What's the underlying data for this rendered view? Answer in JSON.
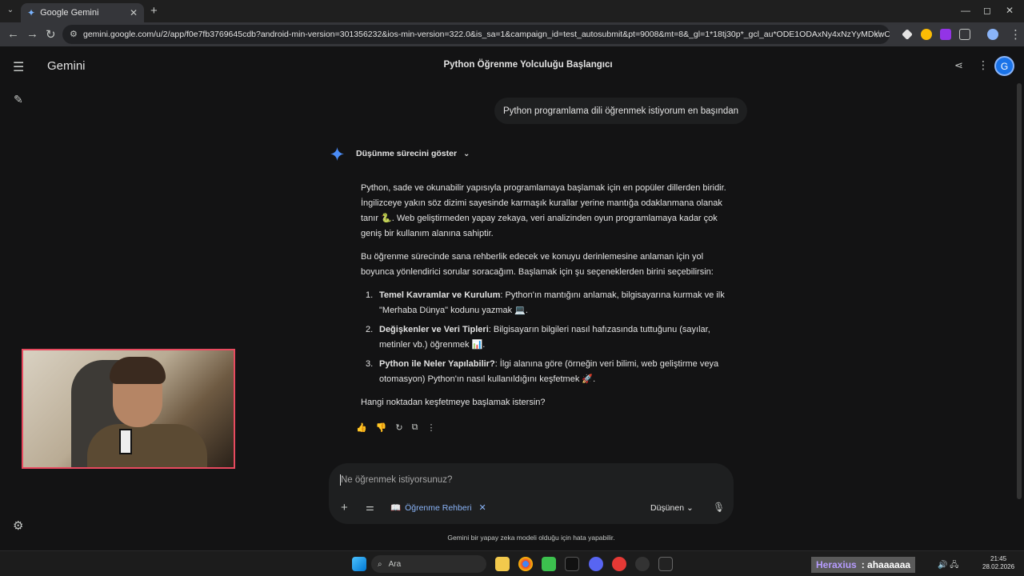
{
  "browser": {
    "tab_title": "Google Gemini",
    "url": "gemini.google.com/u/2/app/f0e7fb3769645cdb?android-min-version=301356232&ios-min-version=322.0&is_sa=1&campaign_id=test_autosubmit&pt=9008&mt=8&_gl=1*18tj30p*_gcl_au*ODE1ODAxNy4xNzYyMDkwOTA2LjUwODE3OT..."
  },
  "app": {
    "brand": "Gemini",
    "chat_title": "Python Öğrenme Yolculuğu Başlangıcı",
    "avatar_letter": "G"
  },
  "conversation": {
    "user_message": "Python programlama dili öğrenmek istiyorum en başından",
    "thinking_label": "Düşünme sürecini göster",
    "paragraph1": "Python, sade ve okunabilir yapısıyla programlamaya başlamak için en popüler dillerden biridir. İngilizceye yakın söz dizimi sayesinde karmaşık kurallar yerine mantığa odaklanmana olanak tanır 🐍. Web geliştirmeden yapay zekaya, veri analizinden oyun programlamaya kadar çok geniş bir kullanım alanına sahiptir.",
    "paragraph2": "Bu öğrenme sürecinde sana rehberlik edecek ve konuyu derinlemesine anlaman için yol boyunca yönlendirici sorular soracağım. Başlamak için şu seçeneklerden birini seçebilirsin:",
    "options": [
      {
        "num": "1.",
        "title": "Temel Kavramlar ve Kurulum",
        "text": ": Python'ın mantığını anlamak, bilgisayarına kurmak ve ilk \"Merhaba Dünya\" kodunu yazmak 💻."
      },
      {
        "num": "2.",
        "title": "Değişkenler ve Veri Tipleri",
        "text": ": Bilgisayarın bilgileri nasıl hafızasında tuttuğunu (sayılar, metinler vb.) öğrenmek 📊."
      },
      {
        "num": "3.",
        "title": "Python ile Neler Yapılabilir?",
        "text": ": İlgi alanına göre (örneğin veri bilimi, web geliştirme veya otomasyon) Python'ın nasıl kullanıldığını keşfetmek 🚀."
      }
    ],
    "closing": "Hangi noktadan keşfetmeye başlamak istersin?"
  },
  "input": {
    "placeholder": "Ne öğrenmek istiyorsunuz?",
    "chip_label": "Öğrenme Rehberi",
    "mode_label": "Düşünen"
  },
  "disclaimer": "Gemini bir yapay zeka modeli olduğu için hata yapabilir.",
  "taskbar": {
    "search_label": "Ara",
    "time": "21:45",
    "date": "28.02.2026"
  },
  "stream_chat": {
    "user": "Heraxius",
    "message": ": ahaaaaaa"
  }
}
